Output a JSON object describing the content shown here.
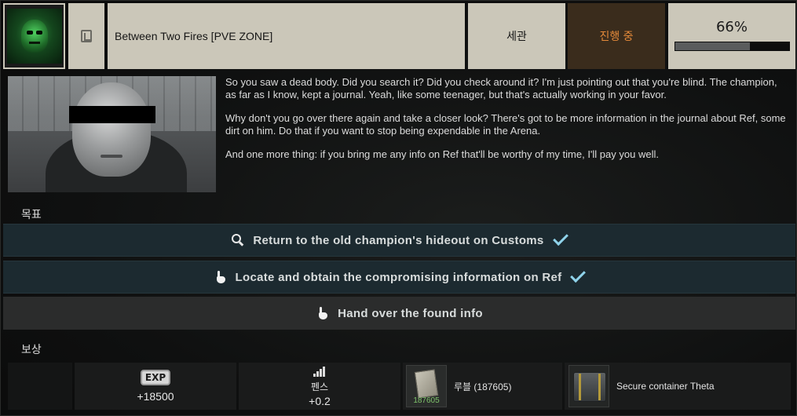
{
  "header": {
    "quest_title": "Between Two Fires [PVE ZONE]",
    "location": "세관",
    "status": "진행 중",
    "progress_label": "66%",
    "progress_value": 0.66,
    "trader_icon": "trader-avatar",
    "quest_type_icon": "exit-door-icon"
  },
  "briefing": [
    "So you saw a dead body. Did you search it? Did you check around it? I'm just pointing out that you're blind. The champion, as far as I know, kept a journal. Yeah, like some teenager, but that's actually working in your favor.",
    "Why don't you go over there again and take a closer look? There's got to be more information in the journal about Ref, some dirt on him. Do that if you want to stop being expendable in the Arena.",
    "And one more thing: if you bring me any info on Ref that'll be worthy of my time, I'll pay you well."
  ],
  "objectives_label": "목표",
  "objectives": [
    {
      "text": "Return to the old champion's hideout on Customs",
      "icon": "search-icon",
      "completed": true
    },
    {
      "text": "Locate and obtain the compromising information on Ref",
      "icon": "hand-icon",
      "completed": true
    },
    {
      "text": "Hand over the found info",
      "icon": "hand-icon",
      "completed": false
    }
  ],
  "rewards_label": "보상",
  "rewards": {
    "exp_icon_text": "EXP",
    "exp_value": "+18500",
    "rep_name": "펜스",
    "rep_value": "+0.2",
    "item1_name": "루블  (187605)",
    "item1_stack": "187605",
    "item2_name": "Secure container Theta"
  },
  "colors": {
    "header_bg": "#cbc7b9",
    "status_text": "#e58a3a",
    "status_bg": "#3a2c1c",
    "objective_done_bg": "#1c2a30",
    "check_color": "#8fd3ea",
    "stack_text": "#7fc36b"
  }
}
